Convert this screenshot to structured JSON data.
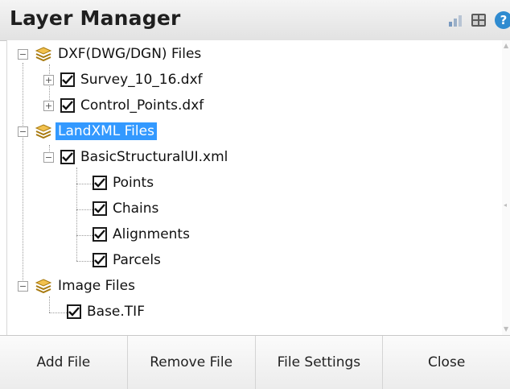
{
  "window": {
    "title": "Layer Manager"
  },
  "titlebar_icons": [
    "layers-icon",
    "grid-icon",
    "help-icon"
  ],
  "help_glyph": "?",
  "tree": {
    "groups": [
      {
        "label": "DXF(DWG/DGN) Files",
        "expanded": true,
        "children": [
          {
            "label": "Survey_10_16.dxf",
            "checked": true,
            "expanded": false
          },
          {
            "label": "Control_Points.dxf",
            "checked": true,
            "expanded": false
          }
        ]
      },
      {
        "label": "LandXML Files",
        "expanded": true,
        "selected": true,
        "children": [
          {
            "label": "BasicStructuralUI.xml",
            "checked": true,
            "expanded": true,
            "children": [
              {
                "label": "Points",
                "checked": true
              },
              {
                "label": "Chains",
                "checked": true
              },
              {
                "label": "Alignments",
                "checked": true
              },
              {
                "label": "Parcels",
                "checked": true
              }
            ]
          }
        ]
      },
      {
        "label": "Image Files",
        "expanded": true,
        "children": [
          {
            "label": "Base.TIF",
            "checked": true
          }
        ]
      }
    ]
  },
  "buttons": {
    "add": "Add File",
    "remove": "Remove File",
    "settings": "File Settings",
    "close": "Close"
  },
  "colors": {
    "selection": "#3399ff",
    "layer_icon": "#d9a520"
  }
}
